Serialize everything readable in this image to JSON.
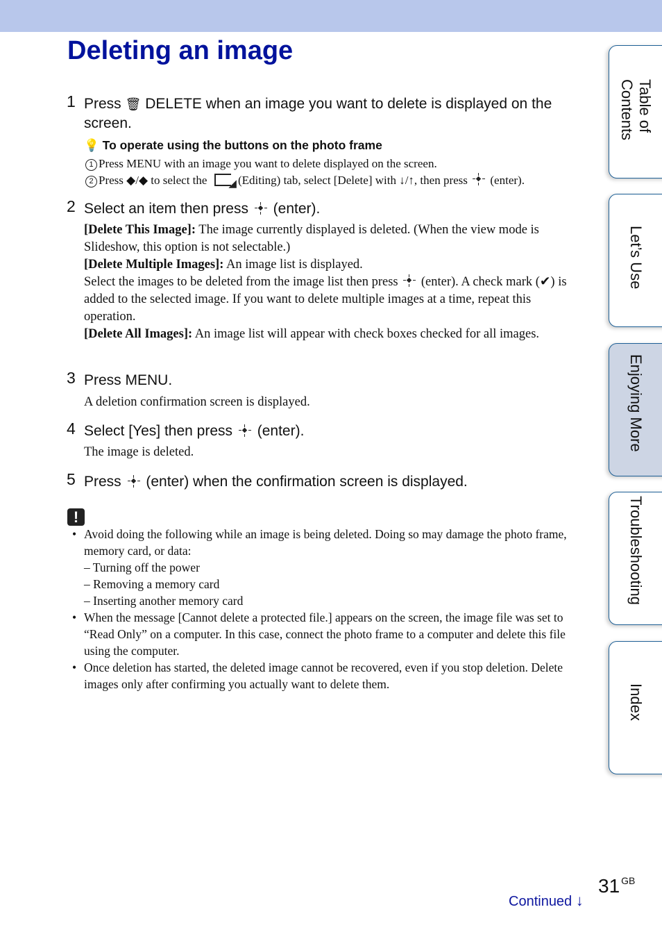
{
  "page": {
    "title": "Deleting an image",
    "number": "31",
    "number_suffix": "GB",
    "continued": "Continued",
    "continued_icon": "down-arrow-icon"
  },
  "colors": {
    "header_band": "#b8c7eb",
    "title": "#00129c",
    "tab_border": "#1d5f95",
    "tab_active_bg": "#cdd5e4",
    "continued": "#0d169f"
  },
  "steps": [
    {
      "num": "1",
      "pre": "Press",
      "icon": "trash-icon",
      "post": "DELETE when an image you want to delete is displayed on the screen."
    },
    {
      "num": "2",
      "pre": "Select an item then press",
      "icon": "enter-icon",
      "post": "(enter)."
    },
    {
      "num": "3",
      "text": "Press MENU."
    },
    {
      "num": "4",
      "pre": "Select [Yes] then press",
      "icon": "enter-icon",
      "post": "(enter)."
    },
    {
      "num": "5",
      "pre": "Press",
      "icon": "enter-icon",
      "post": "(enter) when the confirmation screen is displayed."
    }
  ],
  "hint": {
    "icon": "lightbulb-icon",
    "heading": "To operate using the buttons on the photo frame",
    "item1_marker": "1",
    "item1": "Press MENU with an image you want to delete displayed on the screen.",
    "item2_marker": "2",
    "item2_a": "Press ◆/◆ to select the",
    "item2_b": "(Editing) tab, select [Delete] with ↓/↑, then press",
    "item2_c": "(enter)."
  },
  "step2_body": {
    "opt1_label": "[Delete This Image]:",
    "opt1_text": " The image currently displayed is deleted. (When the view mode is Slideshow, this option is not selectable.)",
    "opt2_label": "[Delete Multiple Images]:",
    "opt2_text": " An image list is displayed.",
    "opt2_more_a": "Select the images to be deleted from the image list then press",
    "opt2_more_b": "(enter). A check mark (✔) is added to the selected image. If you want to delete multiple images at a time, repeat this operation.",
    "opt3_label": "[Delete All Images]:",
    "opt3_text": " An image list will appear with check boxes checked for all images."
  },
  "step3_body": "A deletion confirmation screen is displayed.",
  "step4_body": "The image is deleted.",
  "notes": {
    "icon": "caution-icon",
    "icon_glyph": "!",
    "bullet1": "Avoid doing the following while an image is being deleted. Doing so may damage the photo frame, memory card, or data:",
    "dashes": [
      "– Turning off the power",
      "– Removing a memory card",
      "– Inserting another memory card"
    ],
    "bullet2": "When the message [Cannot delete a protected file.] appears on the screen, the image file was set to “Read Only” on a computer. In this case, connect the photo frame to a computer and delete this file using the computer.",
    "bullet3": "Once deletion has started, the deleted image cannot be recovered, even if you stop deletion. Delete images only after confirming you actually want to delete them."
  },
  "side_tabs": [
    {
      "label": "Table of\nContents",
      "active": false
    },
    {
      "label": "Let’s Use",
      "active": false
    },
    {
      "label": "Enjoying More",
      "active": true
    },
    {
      "label": "Troubleshooting",
      "active": false
    },
    {
      "label": "Index",
      "active": false
    }
  ]
}
